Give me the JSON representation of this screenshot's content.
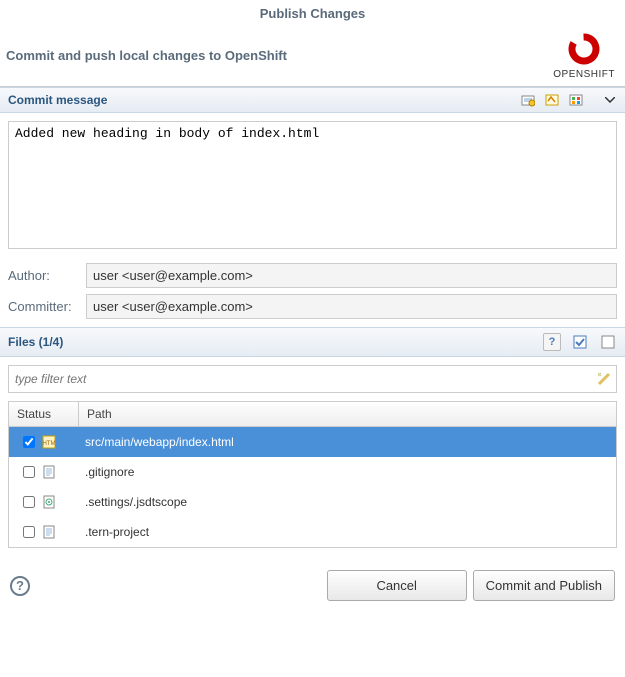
{
  "window": {
    "title": "Publish Changes"
  },
  "header": {
    "description": "Commit and push local changes to OpenShift",
    "brand": "OPENSHIFT"
  },
  "commit": {
    "section_title": "Commit message",
    "message": "Added new heading in body of index.html",
    "author_label": "Author:",
    "author_value": "user <user@example.com>",
    "committer_label": "Committer:",
    "committer_value": "user <user@example.com>"
  },
  "files": {
    "section_title": "Files (1/4)",
    "filter_placeholder": "type filter text",
    "columns": {
      "status": "Status",
      "path": "Path"
    },
    "rows": [
      {
        "checked": true,
        "icon": "html-file-icon",
        "path": "src/main/webapp/index.html",
        "selected": true
      },
      {
        "checked": false,
        "icon": "text-file-icon",
        "path": ".gitignore",
        "selected": false
      },
      {
        "checked": false,
        "icon": "settings-file-icon",
        "path": ".settings/.jsdtscope",
        "selected": false
      },
      {
        "checked": false,
        "icon": "text-file-icon",
        "path": ".tern-project",
        "selected": false
      }
    ]
  },
  "buttons": {
    "cancel": "Cancel",
    "commit": "Commit and Publish"
  },
  "icons": {
    "history": "history-icon",
    "signoff": "signoff-icon",
    "changeid": "changeid-icon",
    "expand": "expand-icon",
    "unknown": "unknown-icon",
    "checkall": "check-all-icon",
    "uncheckall": "uncheck-all-icon",
    "clearfilter": "clear-filter-icon"
  }
}
